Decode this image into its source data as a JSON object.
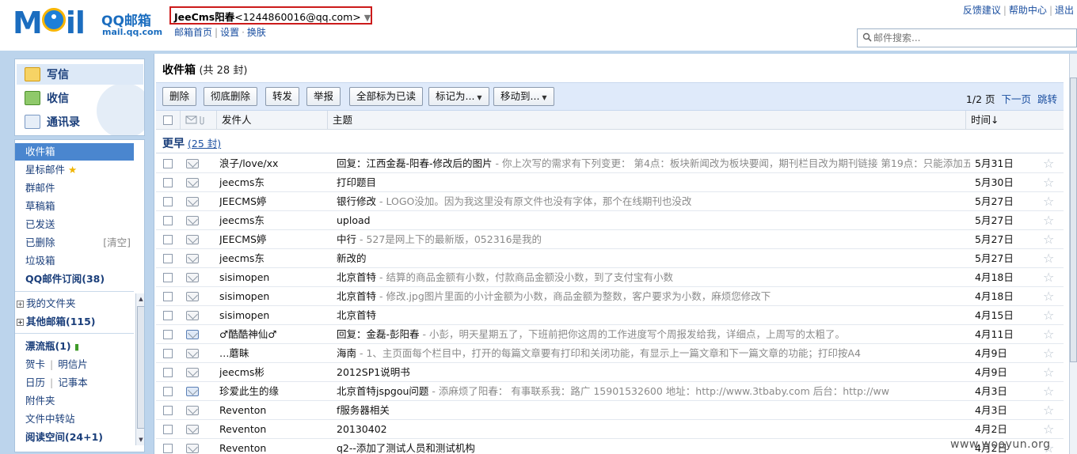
{
  "header": {
    "logo_brand": "QQ邮箱",
    "logo_domain": "mail.qq.com",
    "account_name": "JeeCms阳春",
    "account_email": "<1244860016@qq.com>",
    "nav_links": [
      "邮箱首页",
      "设置",
      "换肤"
    ],
    "top_links": [
      "反馈建议",
      "帮助中心",
      "退出"
    ],
    "search_placeholder": "邮件搜索..."
  },
  "sidebar": {
    "compose": "写信",
    "inbox": "收信",
    "contacts": "通讯录",
    "folders": {
      "inbox": "收件箱",
      "starred": "星标邮件",
      "group": "群邮件",
      "drafts": "草稿箱",
      "sent": "已发送",
      "deleted": "已删除",
      "deleted_clear": "[清空]",
      "spam": "垃圾箱",
      "subscription": "QQ邮件订阅(38)",
      "my_folders": "我的文件夹",
      "other_mailboxes": "其他邮箱(115)",
      "drift_bottle": "漂流瓶(1)",
      "greeting_card": "贺卡",
      "postcard": "明信片",
      "calendar": "日历",
      "notes": "记事本",
      "attachments": "附件夹",
      "file_transfer": "文件中转站",
      "reading_space": "阅读空间(24+1)"
    }
  },
  "main": {
    "title": "收件箱",
    "count": "(共 28 封)",
    "toolbar": {
      "delete": "删除",
      "delete_permanently": "彻底删除",
      "forward": "转发",
      "report": "举报",
      "mark_all_read": "全部标为已读",
      "mark_as": "标记为...",
      "move_to": "移动到..."
    },
    "pager": {
      "page": "1/2 页",
      "next": "下一页",
      "jump": "跳转"
    },
    "columns": {
      "sender": "发件人",
      "subject": "主题",
      "time": "时间↓"
    },
    "group": {
      "label": "更早",
      "count": "(25 封)"
    },
    "emails": [
      {
        "sender": "浪子/love/xx",
        "subject": "回复：江西金磊-阳春-修改后的图片",
        "preview": " - 你上次写的需求有下列变更： 第4点：板块新闻改为板块要闻，期刊栏目改为期刊链接 第19点：只能添加五...",
        "date": "5月31日",
        "replied": false
      },
      {
        "sender": "jeecms东",
        "subject": "打印题目",
        "preview": "",
        "date": "5月30日",
        "replied": false
      },
      {
        "sender": "JEECMS婷",
        "subject": "银行修改",
        "preview": " - LOGO没加。因为我这里没有原文件也没有字体，那个在线期刊也没改",
        "date": "5月27日",
        "replied": false
      },
      {
        "sender": "jeecms东",
        "subject": "upload",
        "preview": "",
        "date": "5月27日",
        "replied": false
      },
      {
        "sender": "JEECMS婷",
        "subject": "中行",
        "preview": " - 527是网上下的最新版，052316是我的",
        "date": "5月27日",
        "replied": false
      },
      {
        "sender": "jeecms东",
        "subject": "新改的",
        "preview": "",
        "date": "5月27日",
        "replied": false
      },
      {
        "sender": "sisimopen",
        "subject": "北京首特",
        "preview": " - 结算的商品金额有小数，付款商品金额没小数，到了支付宝有小数",
        "date": "4月18日",
        "replied": false
      },
      {
        "sender": "sisimopen",
        "subject": "北京首特",
        "preview": " - 修改.jpg图片里面的小计金额为小数，商品金额为整数，客户要求为小数，麻烦您修改下",
        "date": "4月18日",
        "replied": false
      },
      {
        "sender": "sisimopen",
        "subject": "北京首特",
        "preview": "",
        "date": "4月15日",
        "replied": false
      },
      {
        "sender": "♂酷酷神仙♂",
        "subject": "回复：金磊-彭阳春",
        "preview": " - 小彭，明天星期五了，下班前把你这周的工作进度写个周报发给我，详细点，上周写的太粗了。",
        "date": "4月11日",
        "replied": true
      },
      {
        "sender": "…蘑眛",
        "subject": "海南",
        "preview": " - 1、主页面每个栏目中，打开的每篇文章要有打印和关闭功能，有显示上一篇文章和下一篇文章的功能；打印按A4",
        "date": "4月9日",
        "replied": false
      },
      {
        "sender": "jeecms彬",
        "subject": "2012SP1说明书",
        "preview": "",
        "date": "4月9日",
        "replied": false
      },
      {
        "sender": "珍爱此生的缘",
        "subject": "北京首特jspgou问题",
        "preview": " - 添麻烦了阳春：    有事联系我：路广 15901532600    地址：http://www.3tbaby.com    后台：http://ww",
        "date": "4月3日",
        "replied": true
      },
      {
        "sender": "Reventon",
        "subject": "f服务器相关",
        "preview": "",
        "date": "4月3日",
        "replied": false
      },
      {
        "sender": "Reventon",
        "subject": "20130402",
        "preview": "",
        "date": "4月2日",
        "replied": false
      },
      {
        "sender": "Reventon",
        "subject": "q2--添加了测试人员和测试机构",
        "preview": "",
        "date": "4月2日",
        "replied": false
      }
    ]
  },
  "watermark": "www.wooyun.org",
  "colors": {
    "brand": "#1b6dbf",
    "frame": "#bcd4ec",
    "selected": "#4a86cf",
    "highlight_border": "#cc1b1b"
  }
}
